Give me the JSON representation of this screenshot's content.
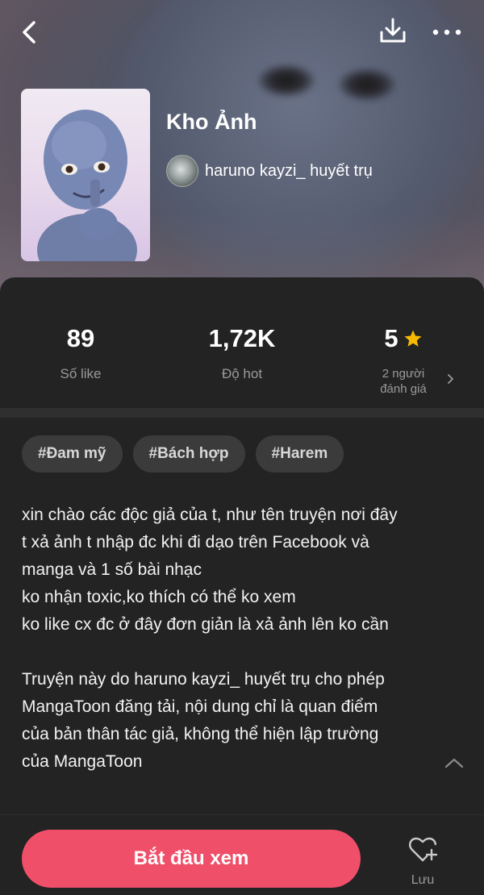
{
  "header": {
    "title": "Kho Ảnh",
    "author": "haruno kayzi_ huyết trụ"
  },
  "icons": {
    "back": "back-chevron-icon",
    "download": "download-icon",
    "more": "more-dots-icon",
    "star": "star-icon",
    "heart_plus": "heart-plus-icon"
  },
  "stats": {
    "likes": {
      "value": "89",
      "label": "Số like"
    },
    "hot": {
      "value": "1,72K",
      "label": "Độ hot"
    },
    "rating": {
      "value": "5",
      "label_line1": "2 người",
      "label_line2": "đánh giá"
    }
  },
  "tags": [
    "#Đam mỹ",
    "#Bách hợp",
    "#Harem"
  ],
  "description": "xin chào các độc giả của t, như tên truyện nơi đây\nt xả ảnh t nhập đc khi đi dạo trên Facebook và\nmanga và 1 số bài nhạc\nko nhận toxic,ko thích có thể ko xem\nko like cx đc ở đây đơn giản là xả ảnh lên ko cần\n\nTruyện này do haruno kayzi_ huyết trụ cho phép\nMangaToon đăng tải, nội dung chỉ là quan điểm\ncủa bản thân tác giả, không thể hiện lập trường\ncủa MangaToon",
  "actions": {
    "start_label": "Bắt đầu xem",
    "save_label": "Lưu"
  },
  "colors": {
    "accent": "#f04f6a",
    "star": "#f7b900",
    "panel": "#232323"
  }
}
